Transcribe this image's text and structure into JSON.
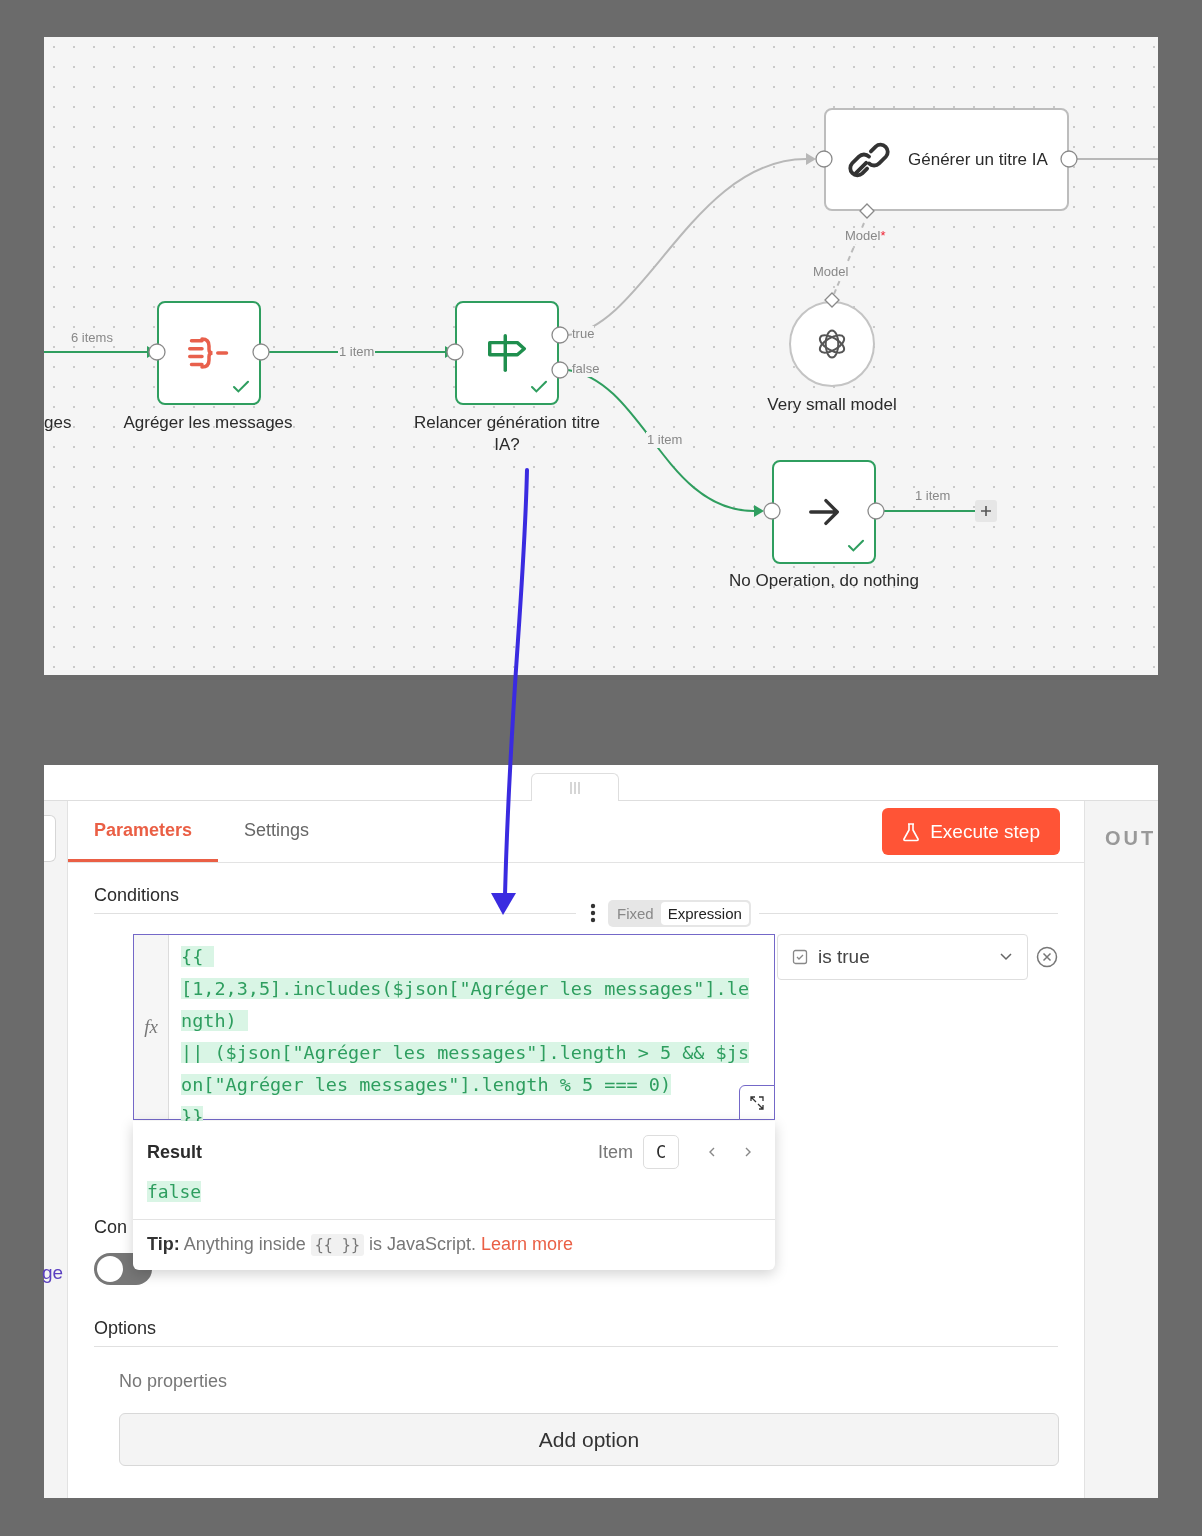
{
  "canvas": {
    "offscreen_label": "ges",
    "nodes": [
      {
        "kind": "aggregate",
        "label": "Agréger les messages",
        "success": true
      },
      {
        "kind": "if",
        "label": "Relancer génération titre IA?",
        "success": true,
        "outputs": [
          "true",
          "false"
        ]
      },
      {
        "kind": "chain",
        "label": "Générer un titre IA",
        "input_label": "Model",
        "required_mark": "*"
      },
      {
        "kind": "model",
        "label": "Very small model",
        "output_label": "Model"
      },
      {
        "kind": "noop",
        "label": "No Operation, do nothing",
        "success": true
      }
    ],
    "edge_labels": [
      "6 items",
      "1 item",
      "1 item",
      "1 item"
    ]
  },
  "panel": {
    "tabs": [
      {
        "label": "Parameters",
        "selected": true
      },
      {
        "label": "Settings",
        "selected": false
      }
    ],
    "execute_button": "Execute step",
    "output_label": "OUT",
    "side_link": "ge",
    "conditions": {
      "title": "Conditions",
      "modes": [
        {
          "label": "Fixed",
          "selected": false
        },
        {
          "label": "Expression",
          "selected": true
        }
      ],
      "gutter_label": "fx",
      "expression_lines": [
        "{{ ",
        "[1,2,3,5].includes($json[\"Agréger les messages\"].le",
        "ngth) ",
        "|| ($json[\"Agréger les messages\"].length > 5 && $js",
        "on[\"Agréger les messages\"].length % 5 === 0)",
        "}}"
      ],
      "operator": "is true"
    },
    "result": {
      "title": "Result",
      "item_label": "Item",
      "item_value": "C",
      "value": "false",
      "tip": "**Tip:** Anything inside",
      "tip_code": "{{ }}",
      "tip_after": "is JavaScript.",
      "tip_link": "Learn more"
    },
    "convert_label": "Con",
    "convert_toggle": {
      "on": false
    },
    "options": {
      "title": "Options",
      "empty_text": "No properties",
      "add_button": "Add option"
    }
  }
}
